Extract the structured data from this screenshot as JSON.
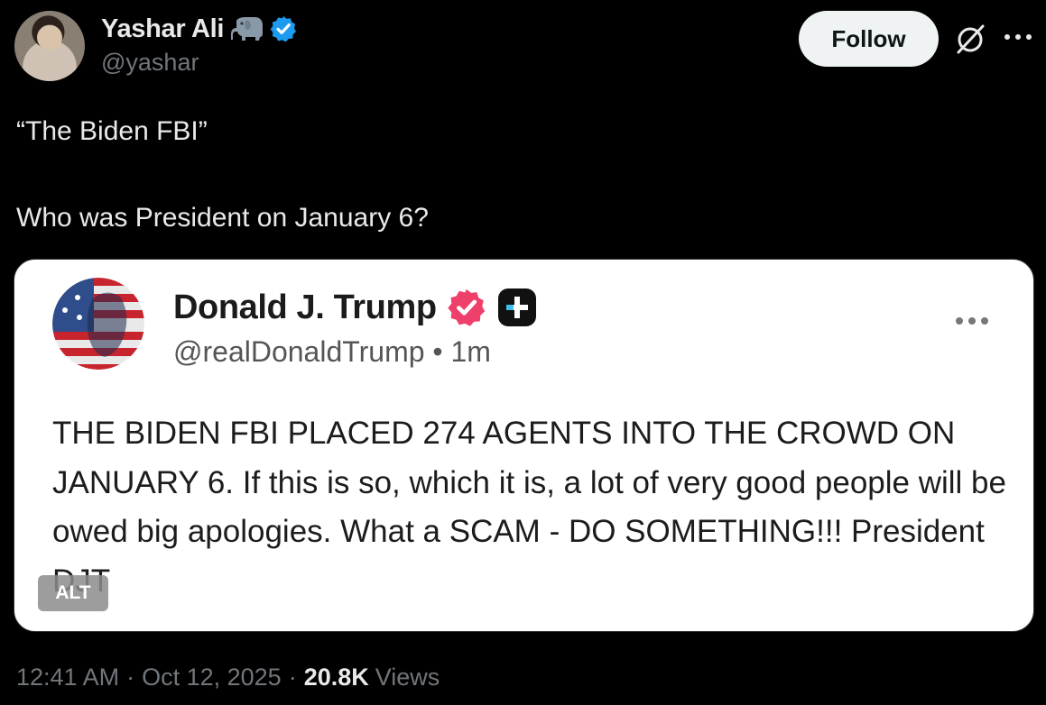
{
  "author": {
    "display_name": "Yashar Ali",
    "handle": "@yashar",
    "badge_icon": "elephant-icon",
    "verified_icon": "verified-badge-icon",
    "verified_color": "#1d9bf0"
  },
  "actions": {
    "follow_label": "Follow",
    "grok_icon": "grok-icon",
    "more_icon": "more-icon"
  },
  "tweet": {
    "line1": "“The Biden FBI”",
    "line2": "Who was President on January 6?"
  },
  "embedded_post": {
    "display_name": "Donald J. Trump",
    "handle": "@realDonaldTrump",
    "separator": "•",
    "time": "1m",
    "badge_color": "#ef3f6b",
    "text": "THE BIDEN FBI PLACED 274 AGENTS INTO THE CROWD ON JANUARY 6. If this is so, which it is, a lot of very good people will be owed big apologies. What a SCAM - DO SOMETHING!!! President DJT",
    "alt_label": "ALT"
  },
  "meta": {
    "time": "12:41 AM",
    "date": "Oct 12, 2025",
    "views_count": "20.8K",
    "views_label": "Views",
    "sep": "·"
  }
}
